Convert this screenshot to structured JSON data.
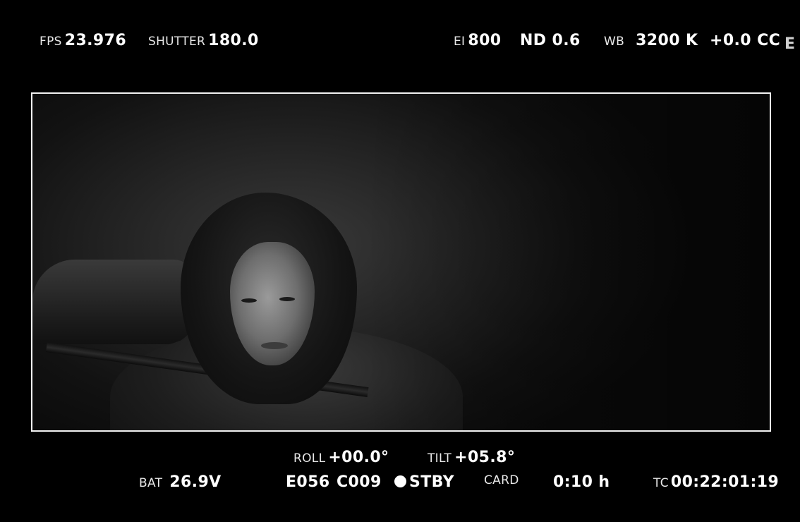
{
  "top_left": {
    "fps_label": "FPS",
    "fps_value": "23.976",
    "shutter_label": "SHUTTER",
    "shutter_value": "180.0"
  },
  "top_right": {
    "ei_label": "EI",
    "ei_value": "800",
    "nd_value": "ND 0.6",
    "wb_label": "WB",
    "wb_value": "3200 K",
    "cc_value": "+0.0 CC",
    "edge_glyph": "E"
  },
  "bottom": {
    "roll_label": "ROLL",
    "roll_value": "+00.0°",
    "tilt_label": "TILT",
    "tilt_value": "+05.8°",
    "bat_label": "BAT",
    "bat_value": "26.9V",
    "reel_value": "E056",
    "clip_value": "C009",
    "status_value": "STBY",
    "card_label": "CARD",
    "card_value": "0:10 h",
    "tc_label": "TC",
    "tc_value": "00:22:01:19"
  }
}
